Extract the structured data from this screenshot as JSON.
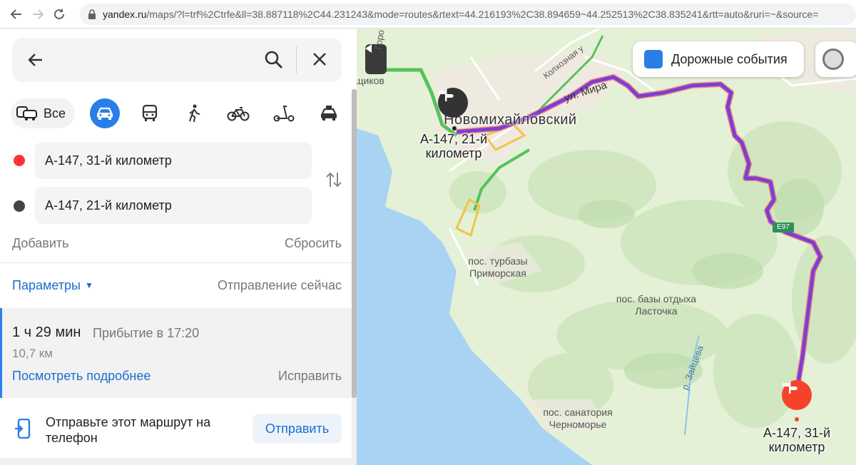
{
  "browser": {
    "url_domain": "yandex.ru",
    "url_path": "/maps/?l=trf%2Ctrfe&ll=38.887118%2C44.231243&mode=routes&rtext=44.216193%2C38.894659~44.252513%2C38.835241&rtt=auto&ruri=~&source="
  },
  "panel": {
    "transport_modes": {
      "all_label": "Все",
      "selected": "car",
      "icons": [
        "car-icon",
        "bus-icon",
        "walk-icon",
        "bike-icon",
        "scooter-icon",
        "taxi-icon"
      ]
    },
    "point_a": "А-147, 31-й километр",
    "point_b": "А-147, 21-й километр",
    "add_label": "Добавить",
    "reset_label": "Сбросить",
    "params_label": "Параметры",
    "departure_label": "Отправление сейчас",
    "route": {
      "duration": "1 ч 29 мин",
      "arrival": "Прибытие в 17:20",
      "distance": "10,7 км",
      "details_label": "Посмотреть подробнее",
      "fix_label": "Исправить"
    },
    "send": {
      "text": "Отправьте этот маршрут на телефон",
      "button_label": "Отправить"
    }
  },
  "map": {
    "traffic_toggle_label": "Дорожные события",
    "traffic_checked": true,
    "labels": {
      "town": "Новомихайловский",
      "street_mira": "ул. Мира",
      "street_kolkhoznaya": "Колхозная у",
      "partial_left": "щиков",
      "partial_left_top": "Горо",
      "start_label": "А-147, 21-й километр",
      "end_label": "А-147, 31-й километр",
      "primorskaya": "пос. турбазы Приморская",
      "lastochka": "пос. базы отдыха Ласточка",
      "chernomorye": "пос. санатория Черноморье",
      "river": "р. Зайцева",
      "road_e97": "E97"
    },
    "colors": {
      "sea": "#a9d3f2",
      "land": "#e4f1d6",
      "route": "#7a3fd6",
      "traffic_green": "#55c35a",
      "accent_blue": "#2a7ee8",
      "end_pin": "#f4432a"
    }
  }
}
